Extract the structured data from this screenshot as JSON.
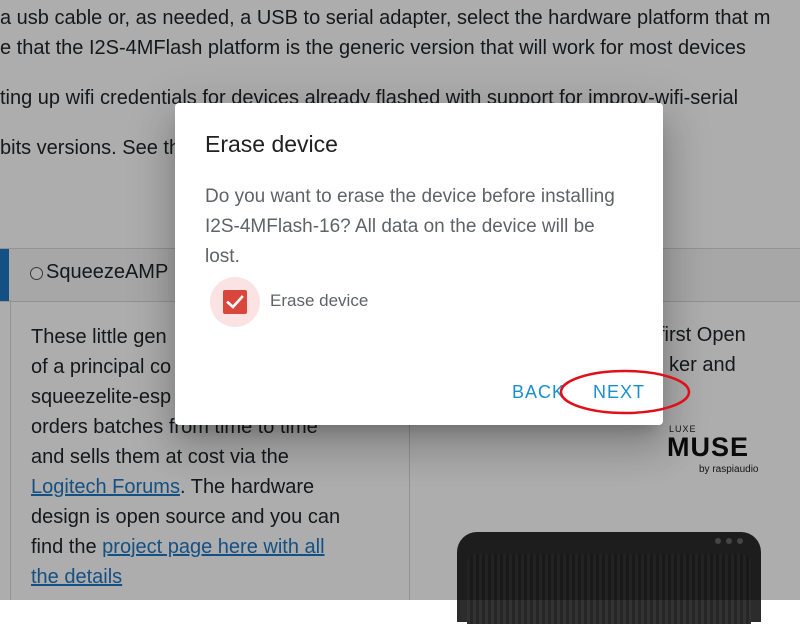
{
  "background": {
    "line1": "a usb cable or, as needed, a USB to serial adapter, select the hardware platform that m",
    "line2": "e that the I2S-4MFlash platform is the generic version that will work for most devices",
    "line3": "ting up wifi credentials for devices already flashed with support for improv-wifi-serial",
    "line4": "bits versions. See th",
    "tab_label": "SqueezeAMP",
    "left_para": {
      "text1": "These little gen",
      "text2": "of a principal co",
      "text3": "squeezelite-esp",
      "text4": "orders batches from time to time",
      "text5": "and sells them at cost via the",
      "link1": "Logitech Forums",
      "text6": ". The hardware",
      "text7": "design is open source and you can",
      "text8": "find the ",
      "link2": "project page here with all",
      "link3": "the details"
    },
    "right_lines": {
      "r1": "first Open",
      "r2": "ker and"
    },
    "muse_logo": {
      "small": "LUXE",
      "big": "MUSE",
      "by": "by raspiaudio"
    }
  },
  "dialog": {
    "title": "Erase device",
    "body": "Do you want to erase the device before installing I2S-4MFlash-16? All data on the device will be lost.",
    "checkbox_label": "Erase device",
    "checkbox_checked": true,
    "back_label": "BACK",
    "next_label": "NEXT"
  },
  "colors": {
    "accent": "#1a8fd0",
    "checkbox": "#d9463b",
    "highlight": "#e0101a",
    "link": "#1f77c4"
  }
}
